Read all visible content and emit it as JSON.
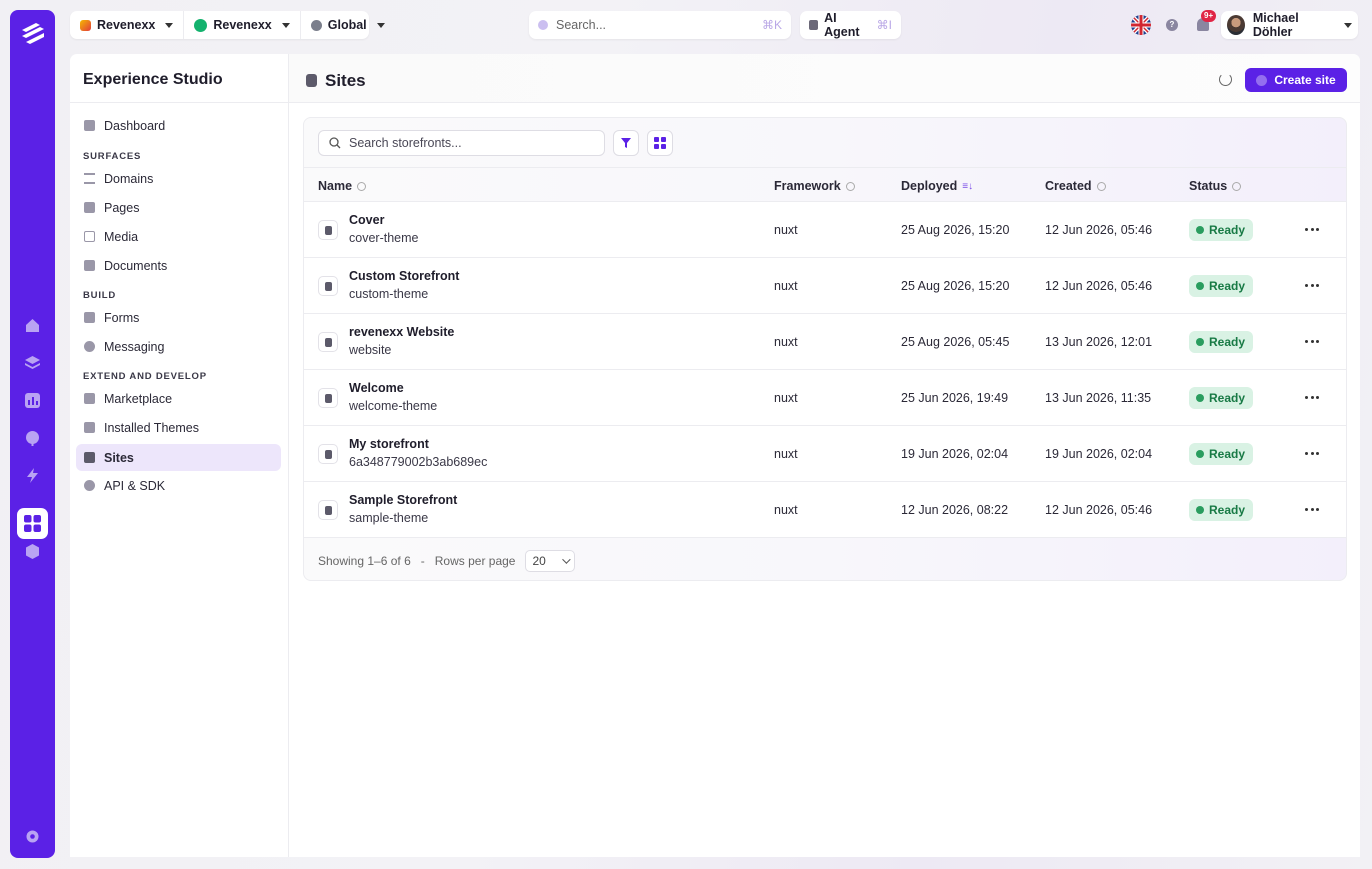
{
  "topbar": {
    "contexts": [
      {
        "label": "Revenexx",
        "icon": "brand-icon"
      },
      {
        "label": "Revenexx",
        "icon": "green-dot-icon"
      },
      {
        "label": "Global",
        "icon": "globe-icon"
      }
    ],
    "search_placeholder": "Search...",
    "search_shortcut": "⌘K",
    "agent_label": "AI Agent",
    "agent_shortcut": "⌘I",
    "notification_count": "9+",
    "user_name": "Michael Döhler"
  },
  "sidebar": {
    "title": "Experience Studio",
    "dashboard": "Dashboard",
    "sections": {
      "surfaces": "SURFACES",
      "build": "BUILD",
      "extend": "EXTEND AND DEVELOP"
    },
    "surfaces": [
      "Domains",
      "Pages",
      "Media",
      "Documents"
    ],
    "build": [
      "Forms",
      "Messaging"
    ],
    "extend": [
      "Marketplace",
      "Installed Themes",
      "Sites",
      "API & SDK"
    ],
    "active": "Sites"
  },
  "page": {
    "title": "Sites",
    "create_label": "Create site",
    "search_placeholder": "Search storefronts..."
  },
  "table": {
    "columns": [
      "Name",
      "Framework",
      "Deployed",
      "Created",
      "Status"
    ],
    "rows": [
      {
        "name": "Cover",
        "slug": "cover-theme",
        "framework": "nuxt",
        "deployed": "25 Aug 2026, 15:20",
        "created": "12 Jun 2026, 05:46",
        "status": "Ready"
      },
      {
        "name": "Custom Storefront",
        "slug": "custom-theme",
        "framework": "nuxt",
        "deployed": "25 Aug 2026, 15:20",
        "created": "12 Jun 2026, 05:46",
        "status": "Ready"
      },
      {
        "name": "revenexx Website",
        "slug": "website",
        "framework": "nuxt",
        "deployed": "25 Aug 2026, 05:45",
        "created": "13 Jun 2026, 12:01",
        "status": "Ready"
      },
      {
        "name": "Welcome",
        "slug": "welcome-theme",
        "framework": "nuxt",
        "deployed": "25 Jun 2026, 19:49",
        "created": "13 Jun 2026, 11:35",
        "status": "Ready"
      },
      {
        "name": "My storefront",
        "slug": "6a348779002b3ab689ec",
        "framework": "nuxt",
        "deployed": "19 Jun 2026, 02:04",
        "created": "19 Jun 2026, 02:04",
        "status": "Ready"
      },
      {
        "name": "Sample Storefront",
        "slug": "sample-theme",
        "framework": "nuxt",
        "deployed": "12 Jun 2026, 08:22",
        "created": "12 Jun 2026, 05:46",
        "status": "Ready"
      }
    ],
    "footer": {
      "showing": "Showing 1–6 of 6",
      "separator": "-",
      "rows_per_page_label": "Rows per page",
      "rows_per_page_value": "20"
    }
  },
  "colors": {
    "accent": "#5b21e6",
    "status_ready_bg": "#d9f2e4",
    "status_ready_text": "#187a45"
  }
}
